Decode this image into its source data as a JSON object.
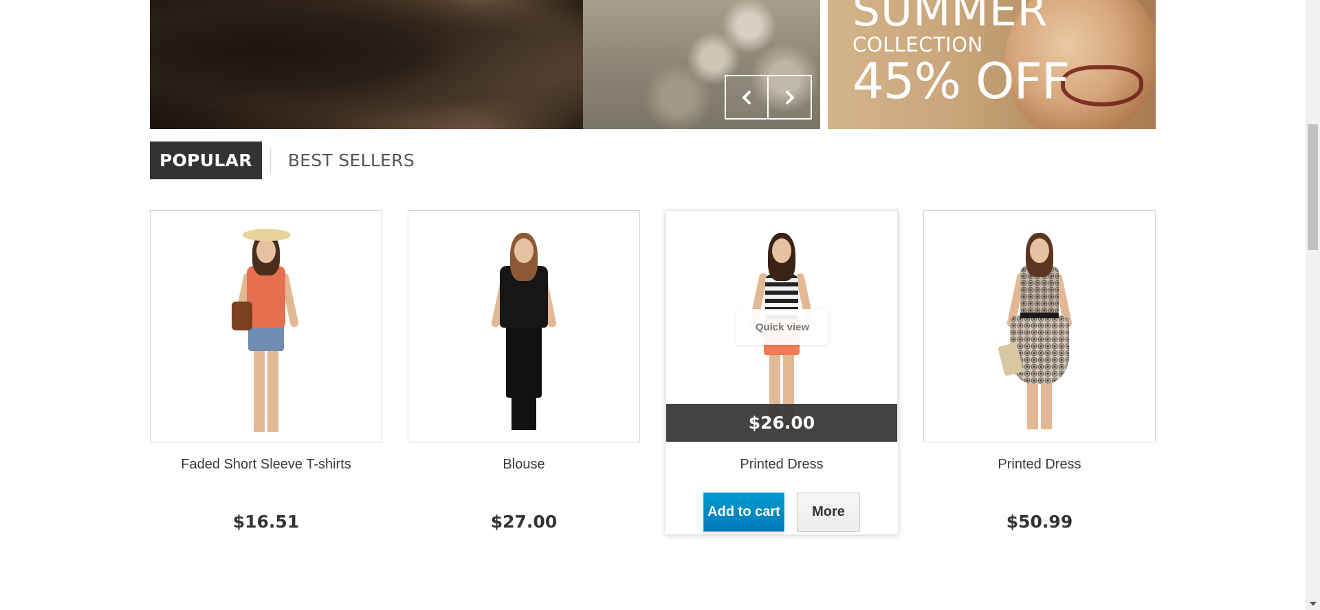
{
  "banner": {
    "promo": {
      "title": "SUMMER",
      "subtitle": "COLLECTION",
      "discount": "45% OFF"
    },
    "controls": {
      "prev_icon": "chevron-left-icon",
      "next_icon": "chevron-right-icon"
    }
  },
  "tabs": [
    {
      "label": "POPULAR",
      "active": true
    },
    {
      "label": "BEST SELLERS",
      "active": false
    }
  ],
  "products": [
    {
      "name": "Faded Short Sleeve T-shirts",
      "price": "$16.51"
    },
    {
      "name": "Blouse",
      "price": "$27.00"
    },
    {
      "name": "Printed Dress",
      "overlay_price": "$26.00",
      "quick_view_label": "Quick view",
      "add_to_cart_label": "Add to cart",
      "more_label": "More"
    },
    {
      "name": "Printed Dress",
      "price": "$50.99"
    }
  ],
  "colors": {
    "accent_blue": "#0088c8",
    "dark": "#333333",
    "tab_active_bg": "#333333"
  }
}
